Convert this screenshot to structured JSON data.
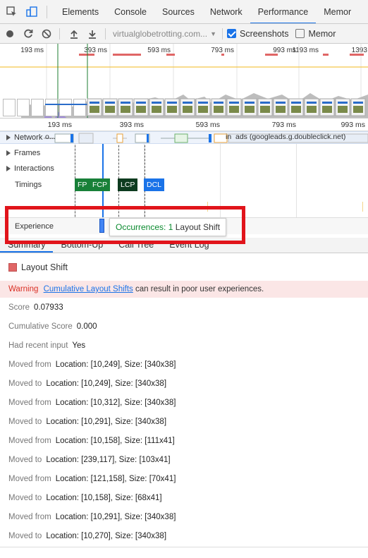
{
  "tabs": [
    "Elements",
    "Console",
    "Sources",
    "Network",
    "Performance",
    "Memor"
  ],
  "active_tab": "Performance",
  "toolbar": {
    "url_label": "virtualglobetrotting.com...",
    "screenshots_label": "Screenshots",
    "memory_label": "Memor"
  },
  "overview": {
    "ticks": [
      "193 ms",
      "393 ms",
      "593 ms",
      "793 ms",
      "993 ms",
      "1193 ms",
      "1393 m"
    ]
  },
  "timeline": {
    "ticks": [
      "193 ms",
      "393 ms",
      "593 ms",
      "793 ms",
      "993 ms"
    ],
    "network_label": "Network",
    "network_detail_1": "o...",
    "network_detail_2": "in",
    "network_detail_3": "ads (googleads.g.doubleclick.net)",
    "frames_label": "Frames",
    "interactions_label": "Interactions",
    "timings_label": "Timings",
    "markers": [
      "FP",
      "FCP",
      "LCP",
      "DCL"
    ],
    "marker_colors": {
      "FP": "#188038",
      "FCP": "#188038",
      "LCP": "#0d3b1f",
      "DCL": "#1a73e8"
    },
    "experience_label": "Experience",
    "tooltip_occurrences": "Occurrences: 1",
    "tooltip_label": "Layout Shift"
  },
  "bottom_tabs": [
    "Summary",
    "Bottom-Up",
    "Call Tree",
    "Event Log"
  ],
  "active_bottom_tab": "Summary",
  "summary": {
    "title": "Layout Shift",
    "warning_label": "Warning",
    "warning_link": "Cumulative Layout Shifts",
    "warning_text": "can result in poor user experiences.",
    "rows": [
      {
        "k": "Score",
        "v": "0.07933"
      },
      {
        "k": "Cumulative Score",
        "v": "0.000"
      },
      {
        "k": "Had recent input",
        "v": "Yes"
      },
      {
        "k": "Moved from",
        "v": "Location: [10,249], Size: [340x38]"
      },
      {
        "k": "Moved to",
        "v": "Location: [10,249], Size: [340x38]"
      },
      {
        "k": "Moved from",
        "v": "Location: [10,312], Size: [340x38]"
      },
      {
        "k": "Moved to",
        "v": "Location: [10,291], Size: [340x38]"
      },
      {
        "k": "Moved from",
        "v": "Location: [10,158], Size: [111x41]"
      },
      {
        "k": "Moved to",
        "v": "Location: [239,117], Size: [103x41]"
      },
      {
        "k": "Moved from",
        "v": "Location: [121,158], Size: [70x41]"
      },
      {
        "k": "Moved to",
        "v": "Location: [10,158], Size: [68x41]"
      },
      {
        "k": "Moved from",
        "v": "Location: [10,291], Size: [340x38]"
      },
      {
        "k": "Moved to",
        "v": "Location: [10,270], Size: [340x38]"
      }
    ]
  },
  "colors": {
    "accent": "#1a73e8",
    "highlight_box": "#e1141b",
    "layout_shift": "#e06666",
    "warning_bg": "#fbe6e6"
  }
}
